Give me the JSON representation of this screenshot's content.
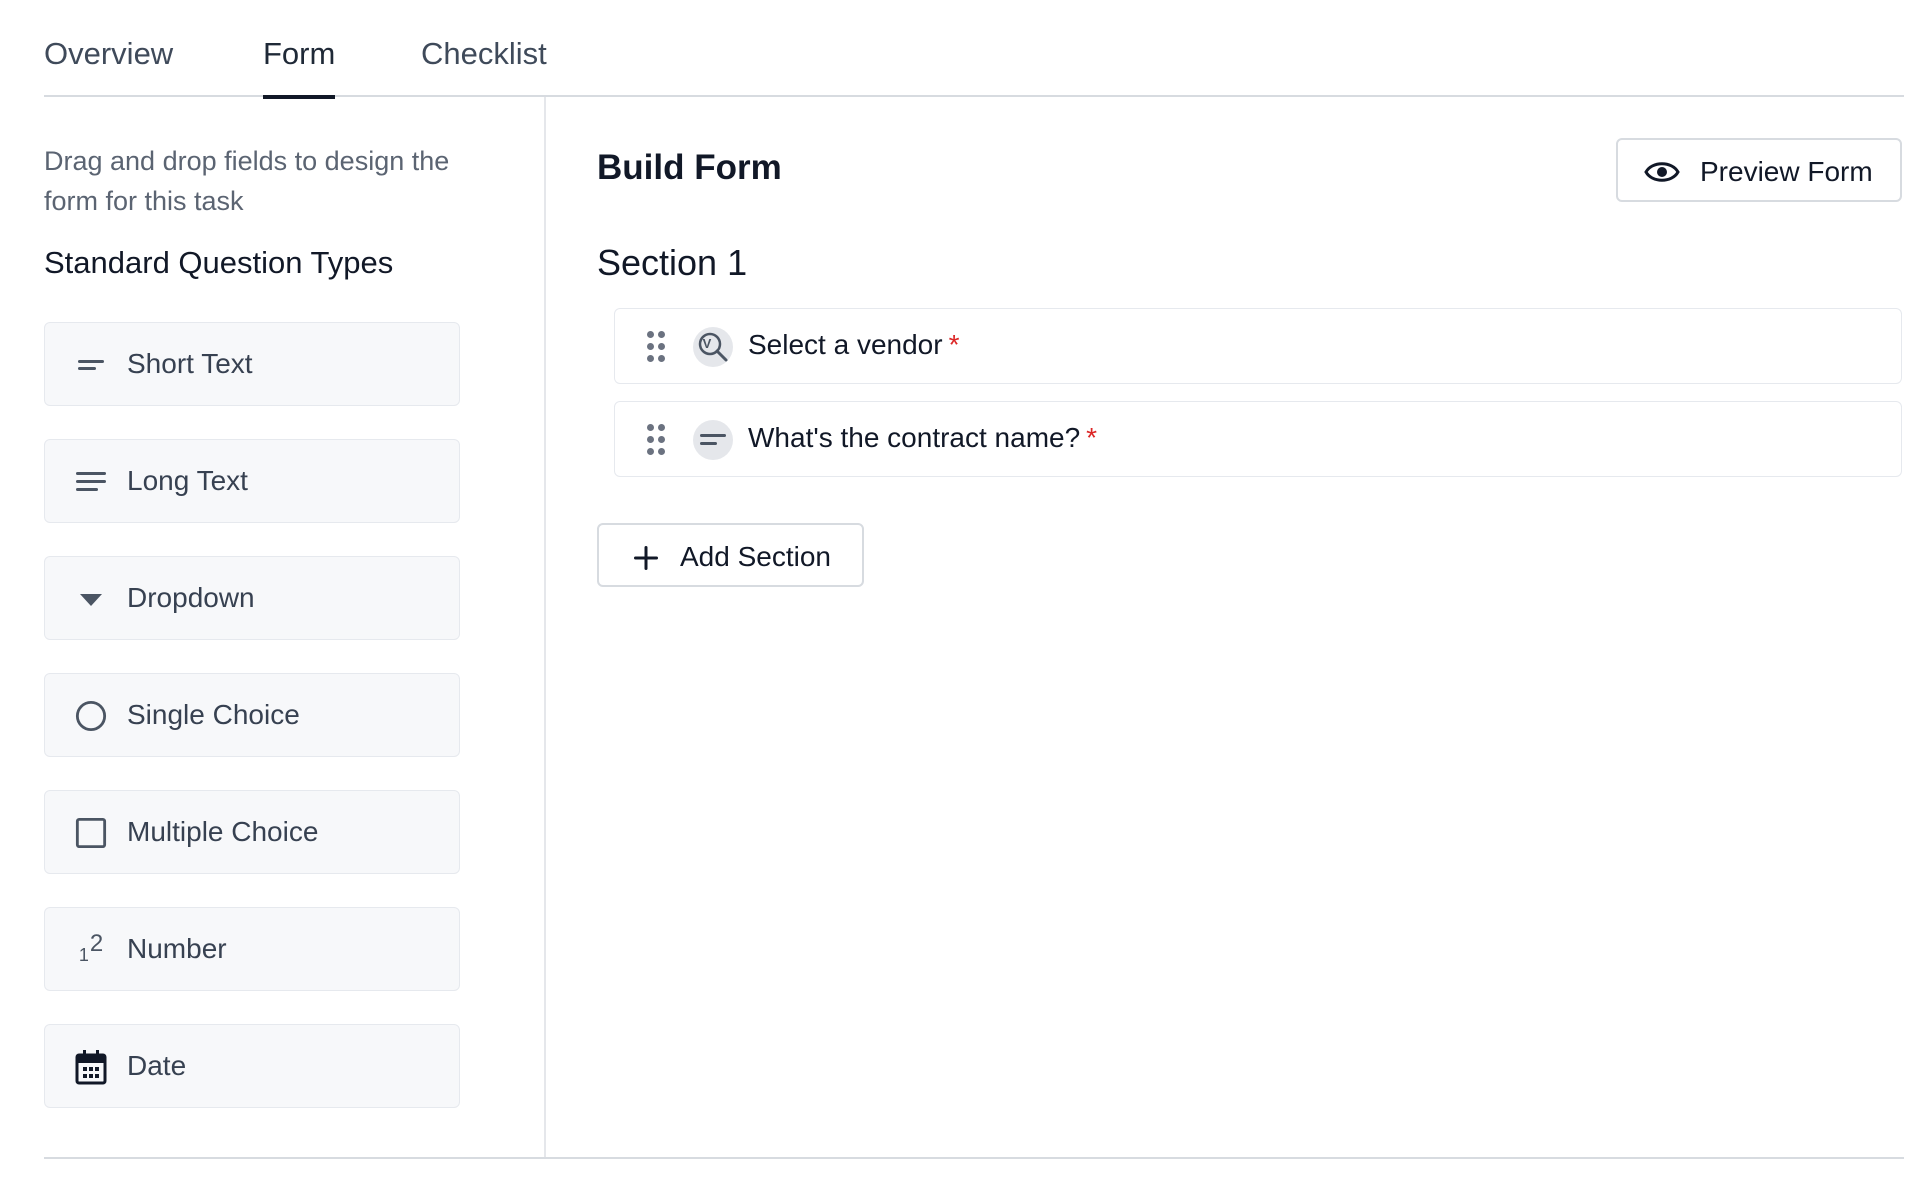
{
  "tabs": [
    {
      "label": "Overview",
      "active": false
    },
    {
      "label": "Form",
      "active": true
    },
    {
      "label": "Checklist",
      "active": false
    }
  ],
  "sidebar": {
    "hint": "Drag and drop fields to design the form for this task",
    "heading": "Standard Question Types",
    "items": [
      {
        "label": "Short Text",
        "icon": "short-text-icon"
      },
      {
        "label": "Long Text",
        "icon": "long-text-icon"
      },
      {
        "label": "Dropdown",
        "icon": "dropdown-caret-icon"
      },
      {
        "label": "Single Choice",
        "icon": "radio-icon"
      },
      {
        "label": "Multiple Choice",
        "icon": "checkbox-icon"
      },
      {
        "label": "Number",
        "icon": "number-icon",
        "glyph_a": "1",
        "glyph_b": "2"
      },
      {
        "label": "Date",
        "icon": "calendar-icon"
      }
    ]
  },
  "main": {
    "title": "Build Form",
    "preview_label": "Preview Form",
    "section_title": "Section 1",
    "fields": [
      {
        "label": "Select a vendor",
        "required_mark": "*",
        "icon": "vendor-search-icon",
        "icon_letter": "V"
      },
      {
        "label": "What's the contract name?",
        "required_mark": "*",
        "icon": "short-text-icon"
      }
    ],
    "add_section_label": "Add Section"
  },
  "colors": {
    "accent": "#111827",
    "required": "#dc2626",
    "card_bg": "#f7f8fa",
    "border": "#d7dbe0"
  }
}
